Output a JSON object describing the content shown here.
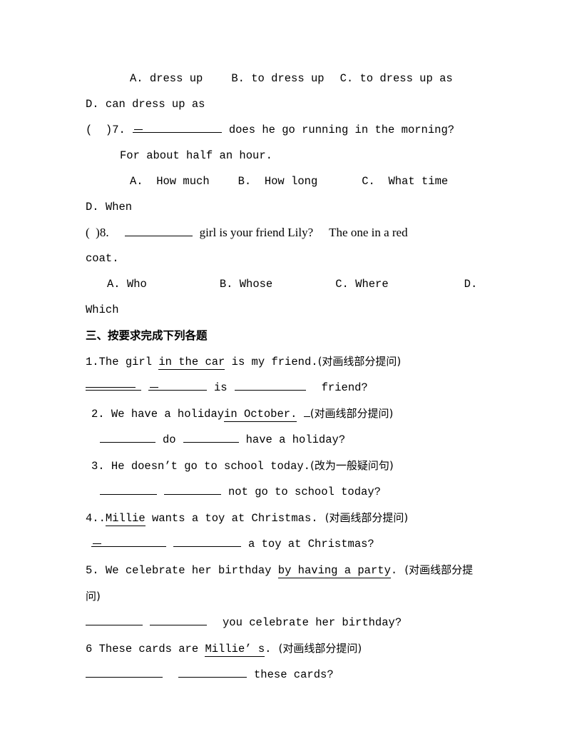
{
  "document": {
    "type": "english-exercise-worksheet",
    "page_background": "#ffffff",
    "text_color": "#000000"
  },
  "q6_options": {
    "a": "A. dress up",
    "b": "B. to dress up",
    "c": "C. to dress up as",
    "d": "D. can dress up as"
  },
  "q7": {
    "marker": "(  )7.",
    "stem_after_blank": "does he go running in the morning?",
    "answer_line": "For about half an hour.",
    "options": {
      "a": "A.  How much",
      "b": "B.  How long",
      "c": "C.  What time",
      "d": "D. When"
    }
  },
  "q8": {
    "marker": "(  )8.",
    "stem_after_blank": "girl is your friend Lily?",
    "stem_tail": "The one in a red",
    "wrap": "coat.",
    "options": {
      "a": "A. Who",
      "b": "B. Whose",
      "c": "C. Where",
      "d": "D.",
      "d_wrap": "Which"
    }
  },
  "section": {
    "heading": "三、按要求完成下列各题"
  },
  "items": [
    {
      "number": "1.",
      "pre": "The girl ",
      "underlined": "in the car",
      "post": " is my friend.",
      "instruction": "(对画线部分提问)",
      "answer": {
        "mid": "is",
        "tail": "friend?"
      }
    },
    {
      "number": "2.",
      "pre": "We have a holiday",
      "underlined": "in October.",
      "post": " ",
      "instruction": "(对画线部分提问)",
      "answer": {
        "mid": "do",
        "tail": "have a holiday?"
      }
    },
    {
      "number": "3.",
      "pre": "He doesn’t go to school today.",
      "underlined": "",
      "post": "",
      "instruction": "(改为一般疑问句)",
      "answer": {
        "tail": "not go to school today?"
      }
    },
    {
      "number": "4..",
      "pre": "",
      "underlined": "Millie",
      "post": " wants a toy at Christmas.",
      "instruction": "(对画线部分提问)",
      "answer": {
        "tail": "a toy at Christmas?"
      }
    },
    {
      "number": "5.",
      "pre": " We celebrate her birthday ",
      "underlined": "by having a party",
      "post": ".",
      "instruction": "(对画线部分提",
      "instruction_wrap": "问)",
      "answer": {
        "tail": "you celebrate her birthday?"
      }
    },
    {
      "number": "6",
      "pre": " These cards are ",
      "underlined": "Millie’ s",
      "post": ".",
      "instruction": "(对画线部分提问)",
      "answer": {
        "tail": "these cards?"
      }
    }
  ]
}
